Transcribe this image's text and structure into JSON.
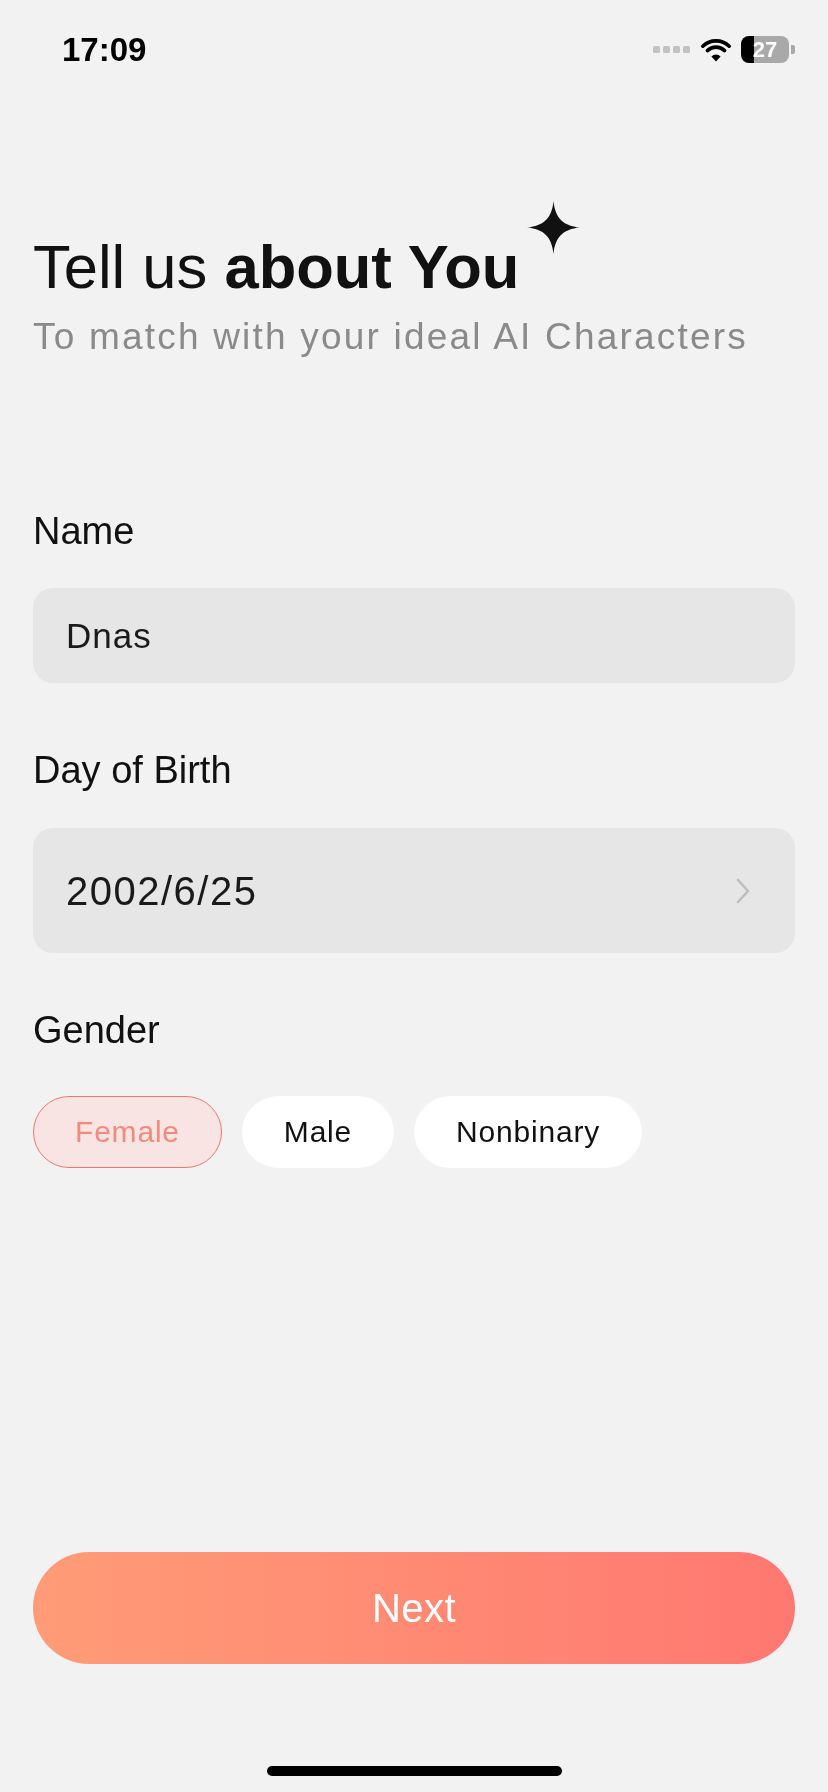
{
  "status_bar": {
    "time": "17:09",
    "battery": "27"
  },
  "header": {
    "title": "Tell us **about You**",
    "subtitle": "To match with your ideal AI Characters"
  },
  "form": {
    "fields": [
      {
        "kind": "text",
        "label": "Name",
        "value": "Dnas"
      },
      {
        "kind": "picker",
        "label": "Day of Birth",
        "value": "2002/6/25"
      }
    ],
    "gender": {
      "label": "Gender",
      "options": [
        {
          "label": "Female",
          "selected": true
        },
        {
          "label": "Male",
          "selected": false
        },
        {
          "label": "Nonbinary",
          "selected": false
        }
      ]
    }
  },
  "next_button": {
    "label": "Next"
  }
}
